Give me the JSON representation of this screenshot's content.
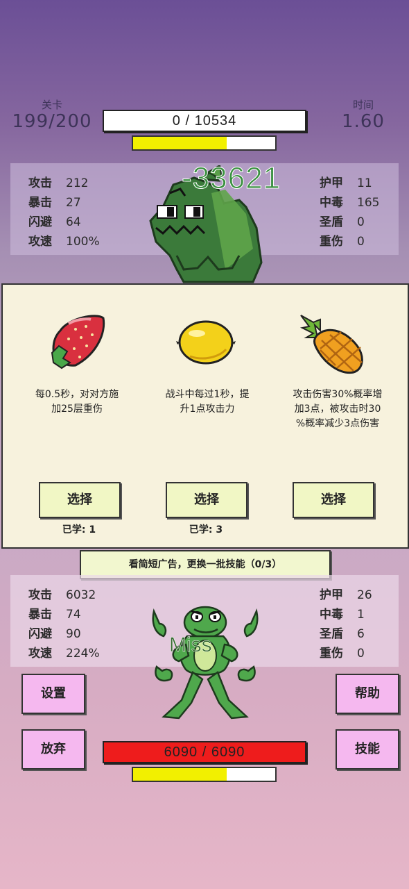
{
  "level": {
    "label": "关卡",
    "value": "199/200"
  },
  "time": {
    "label": "时间",
    "value": "1.60"
  },
  "enemy": {
    "hp_text": "0 / 10534",
    "hp_fraction": 0.0,
    "energy_fraction": 0.66,
    "damage_popup": "-33621",
    "stats_left": [
      {
        "k": "攻击",
        "v": "212"
      },
      {
        "k": "暴击",
        "v": "27"
      },
      {
        "k": "闪避",
        "v": "64"
      },
      {
        "k": "攻速",
        "v": "100%"
      }
    ],
    "stats_right": [
      {
        "k": "护甲",
        "v": "11"
      },
      {
        "k": "中毒",
        "v": "165"
      },
      {
        "k": "圣盾",
        "v": "0"
      },
      {
        "k": "重伤",
        "v": "0"
      }
    ]
  },
  "skills": [
    {
      "icon": "strawberry-icon",
      "desc_lines": [
        "每0.5秒，对对方施",
        "加25层重伤"
      ],
      "button": "选择",
      "learned": "已学: 1"
    },
    {
      "icon": "lemon-icon",
      "desc_lines": [
        "战斗中每过1秒，提",
        "升1点攻击力"
      ],
      "button": "选择",
      "learned": "已学: 3"
    },
    {
      "icon": "pineapple-icon",
      "desc_lines": [
        "攻击伤害30%概率增",
        "加3点，被攻击时30",
        "%概率减少3点伤害"
      ],
      "button": "选择",
      "learned": ""
    }
  ],
  "ad_button": "看简短广告，更换一批技能（0/3）",
  "player": {
    "miss_text": "Miss",
    "hp_text": "6090 / 6090",
    "hp_fraction": 1.0,
    "energy_fraction": 0.66,
    "stats_left": [
      {
        "k": "攻击",
        "v": "6032"
      },
      {
        "k": "暴击",
        "v": "74"
      },
      {
        "k": "闪避",
        "v": "90"
      },
      {
        "k": "攻速",
        "v": "224%"
      }
    ],
    "stats_right": [
      {
        "k": "护甲",
        "v": "26"
      },
      {
        "k": "中毒",
        "v": "1"
      },
      {
        "k": "圣盾",
        "v": "6"
      },
      {
        "k": "重伤",
        "v": "0"
      }
    ]
  },
  "buttons": {
    "settings": "设置",
    "help": "帮助",
    "give_up": "放弃",
    "skills": "技能"
  },
  "colors": {
    "hp_red": "#ee1c1c",
    "energy_yellow": "#f2f000",
    "pink_button": "#f5b8ef",
    "card_bg": "#f7f2dd"
  }
}
